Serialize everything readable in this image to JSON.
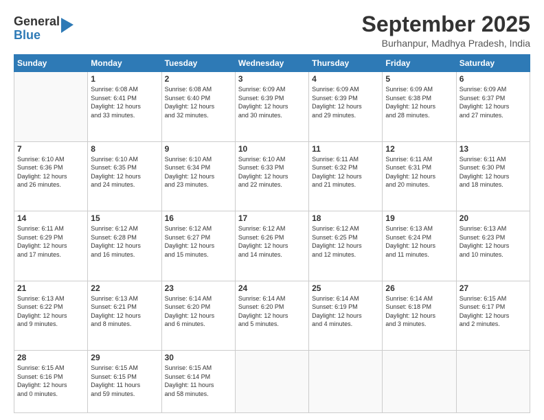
{
  "logo": {
    "general": "General",
    "blue": "Blue"
  },
  "header": {
    "month": "September 2025",
    "location": "Burhanpur, Madhya Pradesh, India"
  },
  "weekdays": [
    "Sunday",
    "Monday",
    "Tuesday",
    "Wednesday",
    "Thursday",
    "Friday",
    "Saturday"
  ],
  "weeks": [
    [
      {
        "day": "",
        "info": ""
      },
      {
        "day": "1",
        "info": "Sunrise: 6:08 AM\nSunset: 6:41 PM\nDaylight: 12 hours\nand 33 minutes."
      },
      {
        "day": "2",
        "info": "Sunrise: 6:08 AM\nSunset: 6:40 PM\nDaylight: 12 hours\nand 32 minutes."
      },
      {
        "day": "3",
        "info": "Sunrise: 6:09 AM\nSunset: 6:39 PM\nDaylight: 12 hours\nand 30 minutes."
      },
      {
        "day": "4",
        "info": "Sunrise: 6:09 AM\nSunset: 6:39 PM\nDaylight: 12 hours\nand 29 minutes."
      },
      {
        "day": "5",
        "info": "Sunrise: 6:09 AM\nSunset: 6:38 PM\nDaylight: 12 hours\nand 28 minutes."
      },
      {
        "day": "6",
        "info": "Sunrise: 6:09 AM\nSunset: 6:37 PM\nDaylight: 12 hours\nand 27 minutes."
      }
    ],
    [
      {
        "day": "7",
        "info": "Sunrise: 6:10 AM\nSunset: 6:36 PM\nDaylight: 12 hours\nand 26 minutes."
      },
      {
        "day": "8",
        "info": "Sunrise: 6:10 AM\nSunset: 6:35 PM\nDaylight: 12 hours\nand 24 minutes."
      },
      {
        "day": "9",
        "info": "Sunrise: 6:10 AM\nSunset: 6:34 PM\nDaylight: 12 hours\nand 23 minutes."
      },
      {
        "day": "10",
        "info": "Sunrise: 6:10 AM\nSunset: 6:33 PM\nDaylight: 12 hours\nand 22 minutes."
      },
      {
        "day": "11",
        "info": "Sunrise: 6:11 AM\nSunset: 6:32 PM\nDaylight: 12 hours\nand 21 minutes."
      },
      {
        "day": "12",
        "info": "Sunrise: 6:11 AM\nSunset: 6:31 PM\nDaylight: 12 hours\nand 20 minutes."
      },
      {
        "day": "13",
        "info": "Sunrise: 6:11 AM\nSunset: 6:30 PM\nDaylight: 12 hours\nand 18 minutes."
      }
    ],
    [
      {
        "day": "14",
        "info": "Sunrise: 6:11 AM\nSunset: 6:29 PM\nDaylight: 12 hours\nand 17 minutes."
      },
      {
        "day": "15",
        "info": "Sunrise: 6:12 AM\nSunset: 6:28 PM\nDaylight: 12 hours\nand 16 minutes."
      },
      {
        "day": "16",
        "info": "Sunrise: 6:12 AM\nSunset: 6:27 PM\nDaylight: 12 hours\nand 15 minutes."
      },
      {
        "day": "17",
        "info": "Sunrise: 6:12 AM\nSunset: 6:26 PM\nDaylight: 12 hours\nand 14 minutes."
      },
      {
        "day": "18",
        "info": "Sunrise: 6:12 AM\nSunset: 6:25 PM\nDaylight: 12 hours\nand 12 minutes."
      },
      {
        "day": "19",
        "info": "Sunrise: 6:13 AM\nSunset: 6:24 PM\nDaylight: 12 hours\nand 11 minutes."
      },
      {
        "day": "20",
        "info": "Sunrise: 6:13 AM\nSunset: 6:23 PM\nDaylight: 12 hours\nand 10 minutes."
      }
    ],
    [
      {
        "day": "21",
        "info": "Sunrise: 6:13 AM\nSunset: 6:22 PM\nDaylight: 12 hours\nand 9 minutes."
      },
      {
        "day": "22",
        "info": "Sunrise: 6:13 AM\nSunset: 6:21 PM\nDaylight: 12 hours\nand 8 minutes."
      },
      {
        "day": "23",
        "info": "Sunrise: 6:14 AM\nSunset: 6:20 PM\nDaylight: 12 hours\nand 6 minutes."
      },
      {
        "day": "24",
        "info": "Sunrise: 6:14 AM\nSunset: 6:20 PM\nDaylight: 12 hours\nand 5 minutes."
      },
      {
        "day": "25",
        "info": "Sunrise: 6:14 AM\nSunset: 6:19 PM\nDaylight: 12 hours\nand 4 minutes."
      },
      {
        "day": "26",
        "info": "Sunrise: 6:14 AM\nSunset: 6:18 PM\nDaylight: 12 hours\nand 3 minutes."
      },
      {
        "day": "27",
        "info": "Sunrise: 6:15 AM\nSunset: 6:17 PM\nDaylight: 12 hours\nand 2 minutes."
      }
    ],
    [
      {
        "day": "28",
        "info": "Sunrise: 6:15 AM\nSunset: 6:16 PM\nDaylight: 12 hours\nand 0 minutes."
      },
      {
        "day": "29",
        "info": "Sunrise: 6:15 AM\nSunset: 6:15 PM\nDaylight: 11 hours\nand 59 minutes."
      },
      {
        "day": "30",
        "info": "Sunrise: 6:15 AM\nSunset: 6:14 PM\nDaylight: 11 hours\nand 58 minutes."
      },
      {
        "day": "",
        "info": ""
      },
      {
        "day": "",
        "info": ""
      },
      {
        "day": "",
        "info": ""
      },
      {
        "day": "",
        "info": ""
      }
    ]
  ]
}
